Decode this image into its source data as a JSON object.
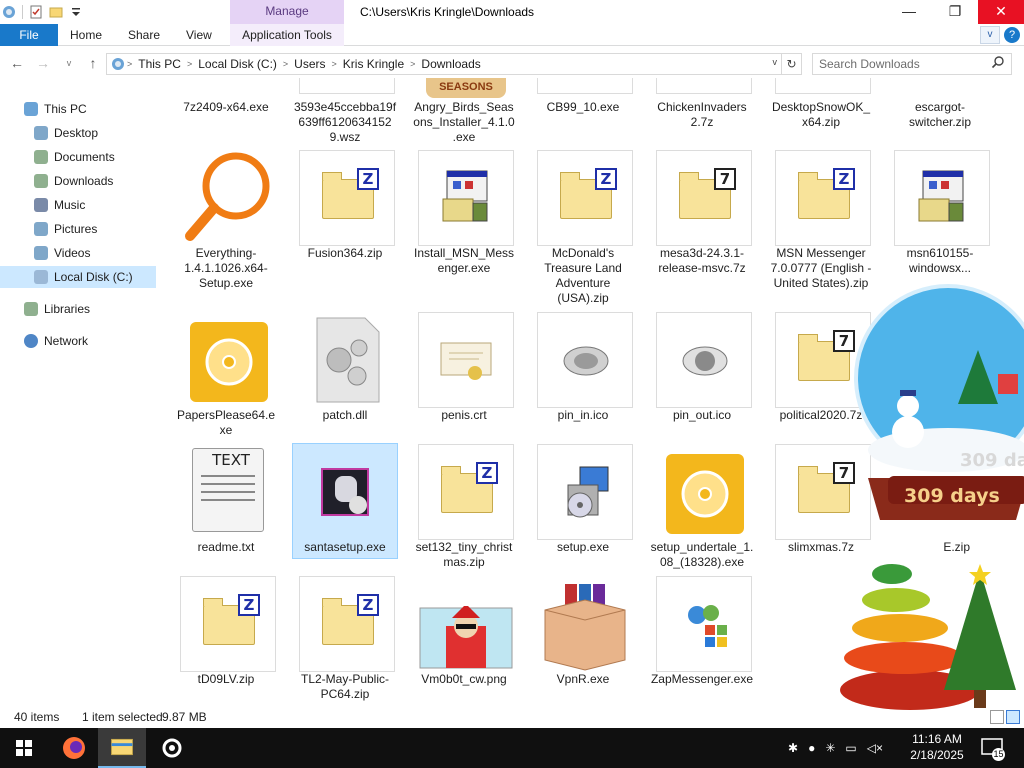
{
  "window": {
    "title_path": "C:\\Users\\Kris Kringle\\Downloads",
    "manage_label": "Manage",
    "caption_min": "—",
    "caption_max": "❐",
    "caption_close": "✕"
  },
  "ribbon": {
    "file": "File",
    "home": "Home",
    "share": "Share",
    "view": "View",
    "app_tools": "Application Tools",
    "expand": "v",
    "help": "?"
  },
  "nav": {
    "back": "←",
    "forward": "→",
    "recent": "v",
    "up": "↑",
    "breadcrumbs": [
      "This PC",
      "Local Disk (C:)",
      "Users",
      "Kris Kringle",
      "Downloads"
    ],
    "separator": ">",
    "refresh": "↻",
    "search_placeholder": "Search Downloads"
  },
  "sidebar": {
    "items": [
      {
        "label": "This PC",
        "icon": "this-pc-icon"
      },
      {
        "label": "Desktop",
        "icon": "desktop-icon"
      },
      {
        "label": "Documents",
        "icon": "documents-icon"
      },
      {
        "label": "Downloads",
        "icon": "downloads-icon"
      },
      {
        "label": "Music",
        "icon": "music-icon"
      },
      {
        "label": "Pictures",
        "icon": "pictures-icon"
      },
      {
        "label": "Videos",
        "icon": "videos-icon"
      },
      {
        "label": "Local Disk (C:)",
        "icon": "local-disk-icon"
      },
      {
        "label": "Libraries",
        "icon": "libraries-icon"
      },
      {
        "label": "Network",
        "icon": "network-icon"
      }
    ]
  },
  "files": {
    "row0": [
      "7z2409-x64.exe",
      "3593e45ccebba19f639ff6120634152 9.wsz",
      "Angry_Birds_Seasons_Installer_4.1.0.exe",
      "CB99_10.exe",
      "ChickenInvaders 2.7z",
      "DesktopSnowOK_x64.zip",
      "escargot-switcher.zip"
    ],
    "row0_banner": "SEASONS",
    "row1": [
      "Everything-1.4.1.1026.x64-Setup.exe",
      "Fusion364.zip",
      "Install_MSN_Messenger.exe",
      "McDonald's Treasure Land Adventure (USA).zip",
      "mesa3d-24.3.1-release-msvc.7z",
      "MSN Messenger 7.0.0777 (English - United States).zip",
      "msn610155-windowsx..."
    ],
    "row2": [
      "PapersPlease64.exe",
      "patch.dll",
      "penis.crt",
      "pin_in.ico",
      "pin_out.ico",
      "political2020.7z"
    ],
    "row3": [
      "readme.txt",
      "santasetup.exe",
      "set132_tiny_christmas.zip",
      "setup.exe",
      "setup_undertale_1.08_(18328).exe",
      "slimxmas.7z",
      "E.zip"
    ],
    "row4": [
      "tD09LV.zip",
      "TL2-May-Public-PC64.zip",
      "Vm0b0t_cw.png",
      "VpnR.exe",
      "ZapMessenger.exe"
    ],
    "readme_badge": "TEXT",
    "zip_letter": "Z",
    "seven_letter": "7"
  },
  "status": {
    "count": "40 items",
    "selection": "1 item selected",
    "size": "9.87 MB"
  },
  "overlay": {
    "days_top": "309 days",
    "days_bottom": "309 days"
  },
  "taskbar": {
    "time": "11:16 AM",
    "date": "2/18/2025",
    "notification_count": "15"
  },
  "colors": {
    "accent": "#1979ca",
    "selection": "#cce8ff",
    "manage": "#e5d3f5",
    "close": "#e81123",
    "taskbar": "#101010"
  }
}
